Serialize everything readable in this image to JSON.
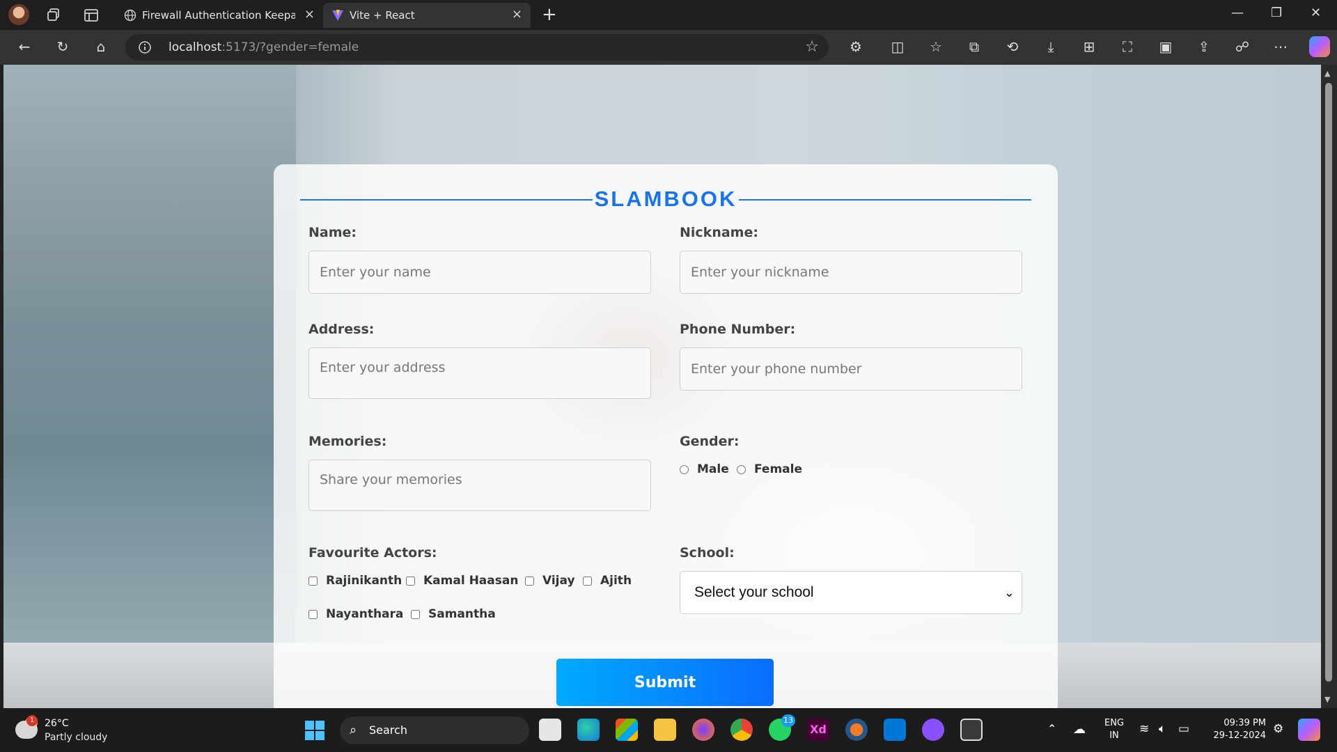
{
  "browser": {
    "tabs": [
      {
        "title": "Firewall Authentication Keepalive",
        "active": false
      },
      {
        "title": "Vite + React",
        "active": true
      }
    ],
    "url_host": "localhost",
    "url_rest": ":5173/?gender=female"
  },
  "form": {
    "title": "SLAMBOOK",
    "name_label": "Name:",
    "name_placeholder": "Enter your name",
    "nickname_label": "Nickname:",
    "nickname_placeholder": "Enter your nickname",
    "address_label": "Address:",
    "address_placeholder": "Enter your address",
    "phone_label": "Phone Number:",
    "phone_placeholder": "Enter your phone number",
    "memories_label": "Memories:",
    "memories_placeholder": "Share your memories",
    "gender_label": "Gender:",
    "gender_options": [
      "Male",
      "Female"
    ],
    "actors_label": "Favourite Actors:",
    "actors": [
      "Rajinikanth",
      "Kamal Haasan",
      "Vijay",
      "Ajith",
      "Nayanthara",
      "Samantha"
    ],
    "school_label": "School:",
    "school_selected": "Select your school",
    "submit_label": "Submit"
  },
  "taskbar": {
    "weather_temp": "26°C",
    "weather_cond": "Partly cloudy",
    "weather_badge": "1",
    "search_label": "Search",
    "whatsapp_badge": "13",
    "lang_1": "ENG",
    "lang_2": "IN",
    "time": "09:39 PM",
    "date": "29-12-2024"
  },
  "colors": {
    "accent": "#1a73e8",
    "submit_start": "#00aaff",
    "submit_end": "#0a6cff"
  }
}
